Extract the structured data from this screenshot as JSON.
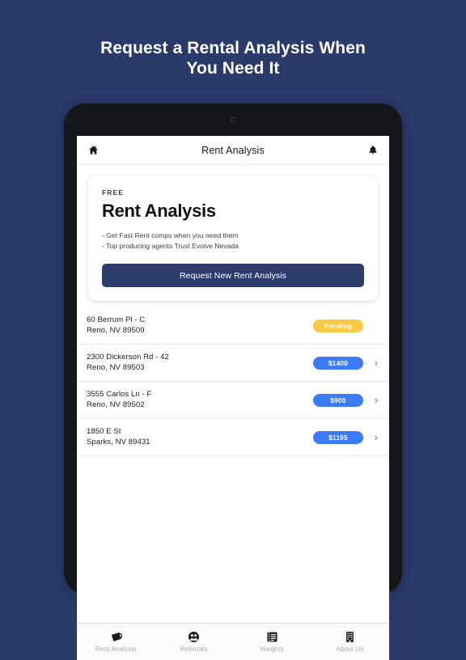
{
  "page": {
    "heading_line1": "Request a Rental Analysis When",
    "heading_line2": "You Need It",
    "background_color": "#2a3a6b"
  },
  "device": {
    "frame_color": "#15171b",
    "camera_icon": "camera-dot",
    "home_button_icon": "home-button-circle"
  },
  "navbar": {
    "home_icon": "home-icon",
    "title": "Rent Analysis",
    "bell_icon": "bell-icon"
  },
  "promo_card": {
    "kicker": "FREE",
    "title": "Rent Analysis",
    "bullets": [
      "- Get Fast Rent comps when you need them",
      "- Top producing agents Trust Evolve Nevada"
    ],
    "button_label": "Request New Rent Analysis",
    "button_color": "#2d3b6d"
  },
  "list": {
    "chevron_icon": "chevron-right-icon",
    "rows": [
      {
        "address_line1": "60 Berrum Pl - C",
        "address_line2": "Reno, NV 89509",
        "badge": "Pending",
        "badge_type": "pending",
        "badge_color": "#fbc944",
        "has_chevron": false
      },
      {
        "address_line1": "2300 Dickerson Rd - 42",
        "address_line2": "Reno, NV 89503",
        "badge": "$1400",
        "badge_type": "price",
        "badge_color": "#3b7bf7",
        "has_chevron": true
      },
      {
        "address_line1": "3555 Carlos Ln - F",
        "address_line2": "Reno, NV 89502",
        "badge": "$900",
        "badge_type": "price",
        "badge_color": "#3b7bf7",
        "has_chevron": true
      },
      {
        "address_line1": "1850 E St",
        "address_line2": "Sparks, NV 89431",
        "badge": "$1195",
        "badge_type": "price",
        "badge_color": "#3b7bf7",
        "has_chevron": true
      }
    ]
  },
  "tabbar": {
    "tabs": [
      {
        "label": "Rent Analysis",
        "icon": "tag-icon"
      },
      {
        "label": "Referrals",
        "icon": "people-circle-icon"
      },
      {
        "label": "Insights",
        "icon": "document-list-icon"
      },
      {
        "label": "About Us",
        "icon": "building-icon"
      }
    ]
  }
}
